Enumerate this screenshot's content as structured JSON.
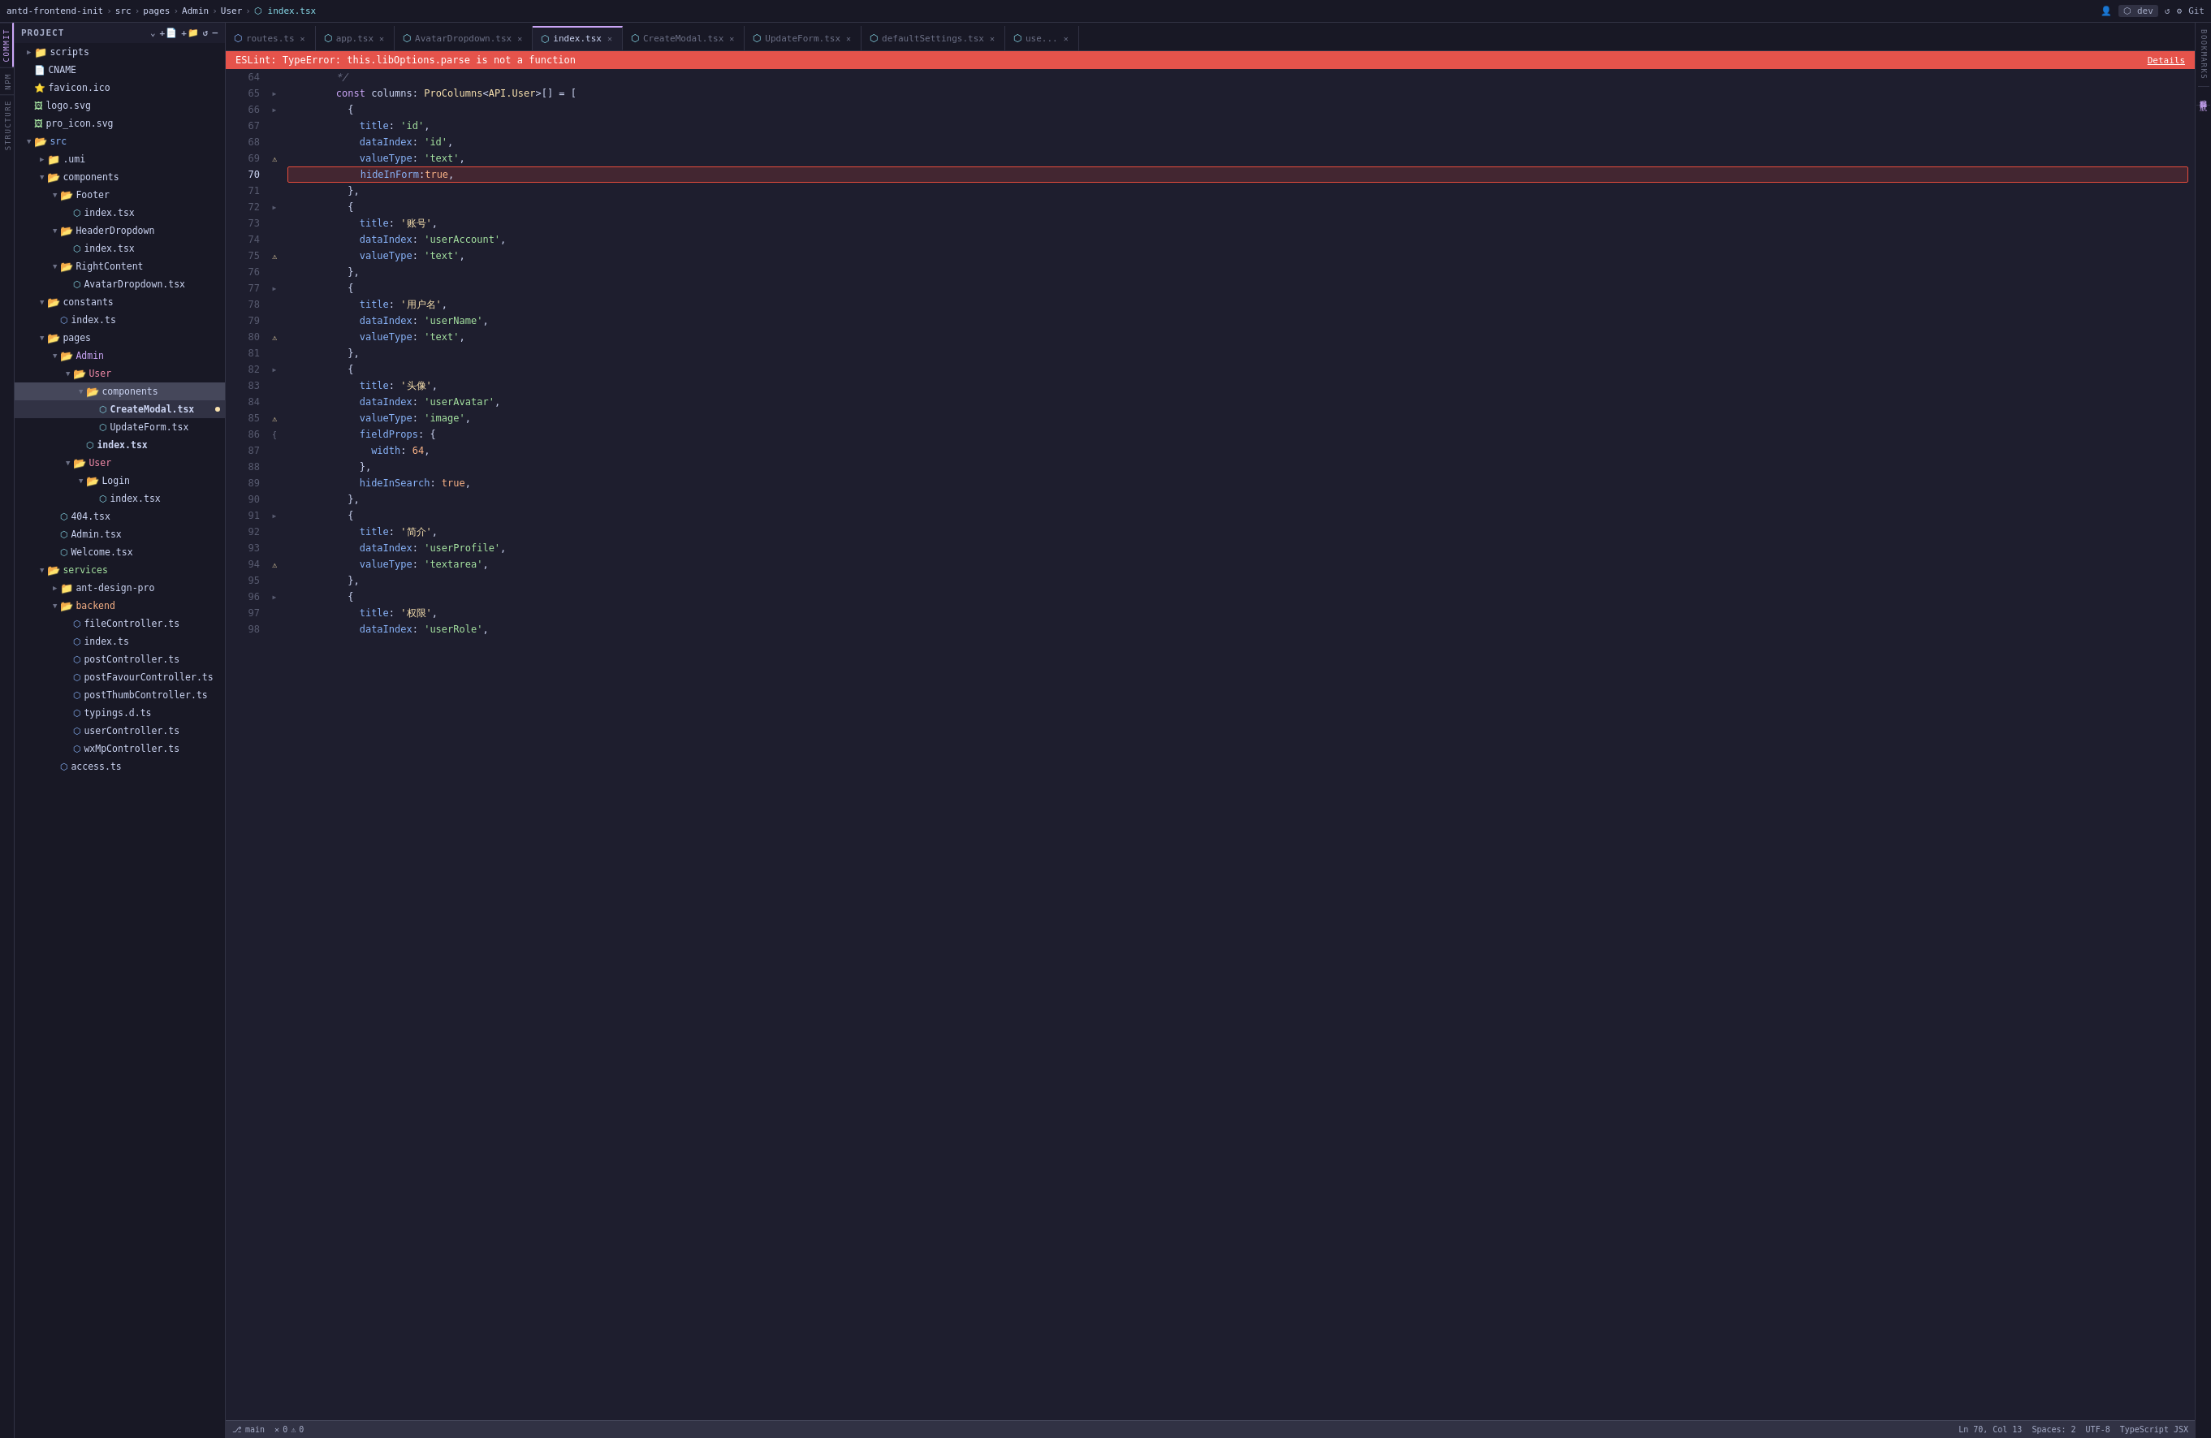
{
  "titleBar": {
    "path": [
      "antd-frontend-init",
      "src",
      "pages",
      "Admin",
      "User",
      "index.tsx"
    ],
    "separators": [
      ">",
      ">",
      ">",
      ">",
      ">"
    ],
    "rightIcons": [
      "user-icon",
      "dev-label",
      "refresh-icon",
      "settings-icon",
      "git-icon"
    ]
  },
  "sidebar": {
    "header": "Project",
    "headerIcons": [
      "chevron-down-icon",
      "new-file-icon",
      "new-folder-icon",
      "refresh-icon",
      "collapse-icon"
    ],
    "tree": [
      {
        "level": 0,
        "type": "folder",
        "open": true,
        "label": "scripts",
        "labelClass": "folder"
      },
      {
        "level": 0,
        "type": "file",
        "icon": "file",
        "label": "CNAME",
        "labelClass": "folder"
      },
      {
        "level": 0,
        "type": "file",
        "icon": "ico",
        "label": "favicon.ico",
        "labelClass": "folder"
      },
      {
        "level": 0,
        "type": "file",
        "icon": "svg",
        "label": "logo.svg",
        "labelClass": "folder"
      },
      {
        "level": 0,
        "type": "file",
        "icon": "svg",
        "label": "pro_icon.svg",
        "labelClass": "folder"
      },
      {
        "level": 0,
        "type": "folder",
        "open": true,
        "label": "src",
        "labelClass": "folder",
        "special": "src"
      },
      {
        "level": 1,
        "type": "folder",
        "open": false,
        "label": ".umi",
        "labelClass": "folder"
      },
      {
        "level": 1,
        "type": "folder",
        "open": true,
        "label": "components",
        "labelClass": "folder"
      },
      {
        "level": 2,
        "type": "folder",
        "open": true,
        "label": "Footer",
        "labelClass": "folder"
      },
      {
        "level": 3,
        "type": "file",
        "icon": "tsx",
        "label": "index.tsx",
        "labelClass": "folder"
      },
      {
        "level": 2,
        "type": "folder",
        "open": true,
        "label": "HeaderDropdown",
        "labelClass": "folder"
      },
      {
        "level": 3,
        "type": "file",
        "icon": "tsx",
        "label": "index.tsx",
        "labelClass": "folder"
      },
      {
        "level": 2,
        "type": "folder",
        "open": true,
        "label": "RightContent",
        "labelClass": "folder"
      },
      {
        "level": 3,
        "type": "file",
        "icon": "tsx",
        "label": "AvatarDropdown.tsx",
        "labelClass": "folder"
      },
      {
        "level": 1,
        "type": "folder",
        "open": true,
        "label": "constants",
        "labelClass": "folder"
      },
      {
        "level": 2,
        "type": "file",
        "icon": "ts",
        "label": "index.ts",
        "labelClass": "folder"
      },
      {
        "level": 1,
        "type": "folder",
        "open": true,
        "label": "pages",
        "labelClass": "folder"
      },
      {
        "level": 2,
        "type": "folder",
        "open": true,
        "label": "Admin",
        "labelClass": "admin-folder"
      },
      {
        "level": 3,
        "type": "folder",
        "open": true,
        "label": "User",
        "labelClass": "user-folder"
      },
      {
        "level": 4,
        "type": "folder",
        "open": true,
        "label": "components",
        "labelClass": "folder",
        "active": true
      },
      {
        "level": 5,
        "type": "file",
        "icon": "tsx",
        "label": "CreateModal.tsx",
        "labelClass": "file-active",
        "hasIndicator": true
      },
      {
        "level": 5,
        "type": "file",
        "icon": "tsx",
        "label": "UpdateForm.tsx",
        "labelClass": "folder",
        "hasIndicator": false
      },
      {
        "level": 4,
        "type": "file",
        "icon": "tsx",
        "label": "index.tsx",
        "labelClass": "file-active"
      },
      {
        "level": 3,
        "type": "folder",
        "open": true,
        "label": "User",
        "labelClass": "user-folder"
      },
      {
        "level": 4,
        "type": "folder",
        "open": true,
        "label": "Login",
        "labelClass": "folder"
      },
      {
        "level": 5,
        "type": "file",
        "icon": "tsx",
        "label": "index.tsx",
        "labelClass": "folder"
      },
      {
        "level": 2,
        "type": "file",
        "icon": "tsx",
        "label": "404.tsx",
        "labelClass": "folder"
      },
      {
        "level": 2,
        "type": "file",
        "icon": "tsx",
        "label": "Admin.tsx",
        "labelClass": "folder"
      },
      {
        "level": 2,
        "type": "file",
        "icon": "tsx",
        "label": "Welcome.tsx",
        "labelClass": "folder"
      },
      {
        "level": 1,
        "type": "folder",
        "open": true,
        "label": "services",
        "labelClass": "services-folder"
      },
      {
        "level": 2,
        "type": "folder",
        "open": false,
        "label": "ant-design-pro",
        "labelClass": "folder"
      },
      {
        "level": 2,
        "type": "folder",
        "open": true,
        "label": "backend",
        "labelClass": "backend-folder"
      },
      {
        "level": 3,
        "type": "file",
        "icon": "ts",
        "label": "fileController.ts",
        "labelClass": "folder"
      },
      {
        "level": 3,
        "type": "file",
        "icon": "ts",
        "label": "index.ts",
        "labelClass": "folder"
      },
      {
        "level": 3,
        "type": "file",
        "icon": "ts",
        "label": "postController.ts",
        "labelClass": "folder"
      },
      {
        "level": 3,
        "type": "file",
        "icon": "ts",
        "label": "postFavourController.ts",
        "labelClass": "folder"
      },
      {
        "level": 3,
        "type": "file",
        "icon": "ts",
        "label": "postThumbController.ts",
        "labelClass": "folder"
      },
      {
        "level": 3,
        "type": "file",
        "icon": "ts",
        "label": "typings.d.ts",
        "labelClass": "folder"
      },
      {
        "level": 3,
        "type": "file",
        "icon": "ts",
        "label": "userController.ts",
        "labelClass": "folder"
      },
      {
        "level": 3,
        "type": "file",
        "icon": "ts",
        "label": "wxMpController.ts",
        "labelClass": "folder"
      },
      {
        "level": 2,
        "type": "file",
        "icon": "ts",
        "label": "access.ts",
        "labelClass": "folder"
      }
    ]
  },
  "tabs": [
    {
      "label": "routes.ts",
      "icon": "ts",
      "active": false,
      "modified": false
    },
    {
      "label": "app.tsx",
      "icon": "tsx",
      "active": false,
      "modified": false
    },
    {
      "label": "AvatarDropdown.tsx",
      "icon": "tsx",
      "active": false,
      "modified": false
    },
    {
      "label": "index.tsx",
      "icon": "tsx",
      "active": true,
      "modified": false
    },
    {
      "label": "CreateModal.tsx",
      "icon": "tsx",
      "active": false,
      "modified": false
    },
    {
      "label": "UpdateForm.tsx",
      "icon": "tsx",
      "active": false,
      "modified": false
    },
    {
      "label": "defaultSettings.tsx",
      "icon": "tsx",
      "active": false,
      "modified": false
    },
    {
      "label": "use...",
      "icon": "tsx",
      "active": false,
      "modified": false
    }
  ],
  "errorBar": {
    "message": "ESLint: TypeError: this.libOptions.parse is not a function",
    "detailsLabel": "Details"
  },
  "codeLines": [
    {
      "num": 64,
      "content": "        */",
      "tokens": [
        {
          "t": "comment",
          "v": "        */"
        }
      ]
    },
    {
      "num": 65,
      "content": "        const columns: ProColumns<API.User>[] = [",
      "tokens": [
        {
          "t": "kw",
          "v": "        const "
        },
        {
          "t": "var",
          "v": "columns"
        },
        {
          "t": "punct",
          "v": ": "
        },
        {
          "t": "type",
          "v": "ProColumns"
        },
        {
          "t": "punct",
          "v": "<"
        },
        {
          "t": "type",
          "v": "API.User"
        },
        {
          "t": "punct",
          "v": ">[] = ["
        }
      ]
    },
    {
      "num": 66,
      "content": "          {",
      "tokens": [
        {
          "t": "punct",
          "v": "          {"
        }
      ]
    },
    {
      "num": 67,
      "content": "            title: 'id',",
      "tokens": [
        {
          "t": "prop",
          "v": "            title"
        },
        {
          "t": "punct",
          "v": ": "
        },
        {
          "t": "str",
          "v": "'id'"
        },
        {
          "t": "punct",
          "v": ","
        }
      ]
    },
    {
      "num": 68,
      "content": "            dataIndex: 'id',",
      "tokens": [
        {
          "t": "prop",
          "v": "            dataIndex"
        },
        {
          "t": "punct",
          "v": ": "
        },
        {
          "t": "str",
          "v": "'id'"
        },
        {
          "t": "punct",
          "v": ","
        }
      ]
    },
    {
      "num": 69,
      "content": "            valueType: 'text',",
      "tokens": [
        {
          "t": "prop",
          "v": "            valueType"
        },
        {
          "t": "punct",
          "v": ": "
        },
        {
          "t": "str",
          "v": "'text'"
        },
        {
          "t": "punct",
          "v": ","
        }
      ]
    },
    {
      "num": 70,
      "content": "            hideInForm:true,",
      "tokens": [
        {
          "t": "prop",
          "v": "            hideInForm"
        },
        {
          "t": "punct",
          "v": ":"
        },
        {
          "t": "bool",
          "v": "true"
        },
        {
          "t": "punct",
          "v": ","
        }
      ],
      "errorHighlight": true
    },
    {
      "num": 71,
      "content": "          },",
      "tokens": [
        {
          "t": "punct",
          "v": "          },"
        }
      ]
    },
    {
      "num": 72,
      "content": "          {",
      "tokens": [
        {
          "t": "punct",
          "v": "          {"
        }
      ]
    },
    {
      "num": 73,
      "content": "            title: '账号',",
      "tokens": [
        {
          "t": "prop",
          "v": "            title"
        },
        {
          "t": "punct",
          "v": ": "
        },
        {
          "t": "str-cn",
          "v": "'账号'"
        },
        {
          "t": "punct",
          "v": ","
        }
      ]
    },
    {
      "num": 74,
      "content": "            dataIndex: 'userAccount',",
      "tokens": [
        {
          "t": "prop",
          "v": "            dataIndex"
        },
        {
          "t": "punct",
          "v": ": "
        },
        {
          "t": "str",
          "v": "'userAccount'"
        },
        {
          "t": "punct",
          "v": ","
        }
      ]
    },
    {
      "num": 75,
      "content": "            valueType: 'text',",
      "tokens": [
        {
          "t": "prop",
          "v": "            valueType"
        },
        {
          "t": "punct",
          "v": ": "
        },
        {
          "t": "str",
          "v": "'text'"
        },
        {
          "t": "punct",
          "v": ","
        }
      ]
    },
    {
      "num": 76,
      "content": "          },",
      "tokens": [
        {
          "t": "punct",
          "v": "          },"
        }
      ]
    },
    {
      "num": 77,
      "content": "          {",
      "tokens": [
        {
          "t": "punct",
          "v": "          {"
        }
      ]
    },
    {
      "num": 78,
      "content": "            title: '用户名',",
      "tokens": [
        {
          "t": "prop",
          "v": "            title"
        },
        {
          "t": "punct",
          "v": ": "
        },
        {
          "t": "str-cn",
          "v": "'用户名'"
        },
        {
          "t": "punct",
          "v": ","
        }
      ]
    },
    {
      "num": 79,
      "content": "            dataIndex: 'userName',",
      "tokens": [
        {
          "t": "prop",
          "v": "            dataIndex"
        },
        {
          "t": "punct",
          "v": ": "
        },
        {
          "t": "str",
          "v": "'userName'"
        },
        {
          "t": "punct",
          "v": ","
        }
      ]
    },
    {
      "num": 80,
      "content": "            valueType: 'text',",
      "tokens": [
        {
          "t": "prop",
          "v": "            valueType"
        },
        {
          "t": "punct",
          "v": ": "
        },
        {
          "t": "str",
          "v": "'text'"
        },
        {
          "t": "punct",
          "v": ","
        }
      ]
    },
    {
      "num": 81,
      "content": "          },",
      "tokens": [
        {
          "t": "punct",
          "v": "          },"
        }
      ]
    },
    {
      "num": 82,
      "content": "          {",
      "tokens": [
        {
          "t": "punct",
          "v": "          {"
        }
      ]
    },
    {
      "num": 83,
      "content": "            title: '头像',",
      "tokens": [
        {
          "t": "prop",
          "v": "            title"
        },
        {
          "t": "punct",
          "v": ": "
        },
        {
          "t": "str-cn",
          "v": "'头像'"
        },
        {
          "t": "punct",
          "v": ","
        }
      ]
    },
    {
      "num": 84,
      "content": "            dataIndex: 'userAvatar',",
      "tokens": [
        {
          "t": "prop",
          "v": "            dataIndex"
        },
        {
          "t": "punct",
          "v": ": "
        },
        {
          "t": "str",
          "v": "'userAvatar'"
        },
        {
          "t": "punct",
          "v": ","
        }
      ]
    },
    {
      "num": 85,
      "content": "            valueType: 'image',",
      "tokens": [
        {
          "t": "prop",
          "v": "            valueType"
        },
        {
          "t": "punct",
          "v": ": "
        },
        {
          "t": "str",
          "v": "'image'"
        },
        {
          "t": "punct",
          "v": ","
        }
      ]
    },
    {
      "num": 86,
      "content": "            fieldProps: {",
      "tokens": [
        {
          "t": "prop",
          "v": "            fieldProps"
        },
        {
          "t": "punct",
          "v": ": {"
        }
      ]
    },
    {
      "num": 87,
      "content": "              width: 64,",
      "tokens": [
        {
          "t": "prop",
          "v": "              width"
        },
        {
          "t": "punct",
          "v": ": "
        },
        {
          "t": "num",
          "v": "64"
        },
        {
          "t": "punct",
          "v": ","
        }
      ]
    },
    {
      "num": 88,
      "content": "            },",
      "tokens": [
        {
          "t": "punct",
          "v": "            },"
        }
      ]
    },
    {
      "num": 89,
      "content": "            hideInSearch: true,",
      "tokens": [
        {
          "t": "prop",
          "v": "            hideInSearch"
        },
        {
          "t": "punct",
          "v": ": "
        },
        {
          "t": "bool",
          "v": "true"
        },
        {
          "t": "punct",
          "v": ","
        }
      ]
    },
    {
      "num": 90,
      "content": "          },",
      "tokens": [
        {
          "t": "punct",
          "v": "          },"
        }
      ]
    },
    {
      "num": 91,
      "content": "          {",
      "tokens": [
        {
          "t": "punct",
          "v": "          {"
        }
      ]
    },
    {
      "num": 92,
      "content": "            title: '简介',",
      "tokens": [
        {
          "t": "prop",
          "v": "            title"
        },
        {
          "t": "punct",
          "v": ": "
        },
        {
          "t": "str-cn",
          "v": "'简介'"
        },
        {
          "t": "punct",
          "v": ","
        }
      ]
    },
    {
      "num": 93,
      "content": "            dataIndex: 'userProfile',",
      "tokens": [
        {
          "t": "prop",
          "v": "            dataIndex"
        },
        {
          "t": "punct",
          "v": ": "
        },
        {
          "t": "str",
          "v": "'userProfile'"
        },
        {
          "t": "punct",
          "v": ","
        }
      ]
    },
    {
      "num": 94,
      "content": "            valueType: 'textarea',",
      "tokens": [
        {
          "t": "prop",
          "v": "            valueType"
        },
        {
          "t": "punct",
          "v": ": "
        },
        {
          "t": "str",
          "v": "'textarea'"
        },
        {
          "t": "punct",
          "v": ","
        }
      ]
    },
    {
      "num": 95,
      "content": "          },",
      "tokens": [
        {
          "t": "punct",
          "v": "          },"
        }
      ]
    },
    {
      "num": 96,
      "content": "          {",
      "tokens": [
        {
          "t": "punct",
          "v": "          {"
        }
      ]
    },
    {
      "num": 97,
      "content": "            title: '权限',",
      "tokens": [
        {
          "t": "prop",
          "v": "            title"
        },
        {
          "t": "punct",
          "v": ": "
        },
        {
          "t": "str-cn",
          "v": "'权限'"
        },
        {
          "t": "punct",
          "v": ","
        }
      ]
    },
    {
      "num": 98,
      "content": "            dataIndex: 'userRole',",
      "tokens": [
        {
          "t": "prop",
          "v": "            dataIndex"
        },
        {
          "t": "punct",
          "v": ": "
        },
        {
          "t": "str",
          "v": "'userRole'"
        },
        {
          "t": "punct",
          "v": ","
        }
      ]
    }
  ],
  "gutterIndicators": {
    "69": "warn",
    "75": "warn",
    "80": "warn",
    "85": "warn",
    "86": "fold",
    "94": "warn"
  },
  "foldIndicators": [
    65,
    66,
    72,
    77,
    82,
    91,
    96
  ],
  "statusBar": {
    "left": [
      {
        "icon": "git-icon",
        "label": "main"
      },
      {
        "icon": "error-icon",
        "label": "0 errors"
      },
      {
        "icon": "warning-icon",
        "label": "0 warnings"
      }
    ],
    "right": [
      {
        "label": "Ln 70, Col 13"
      },
      {
        "label": "Spaces: 2"
      },
      {
        "label": "UTF-8"
      },
      {
        "label": "TypeScript JSX"
      }
    ]
  },
  "sideLabels": {
    "left": [
      "Commit",
      "npm",
      "Structure"
    ],
    "right": [
      "Bookmarks",
      "编程导航"
    ]
  }
}
